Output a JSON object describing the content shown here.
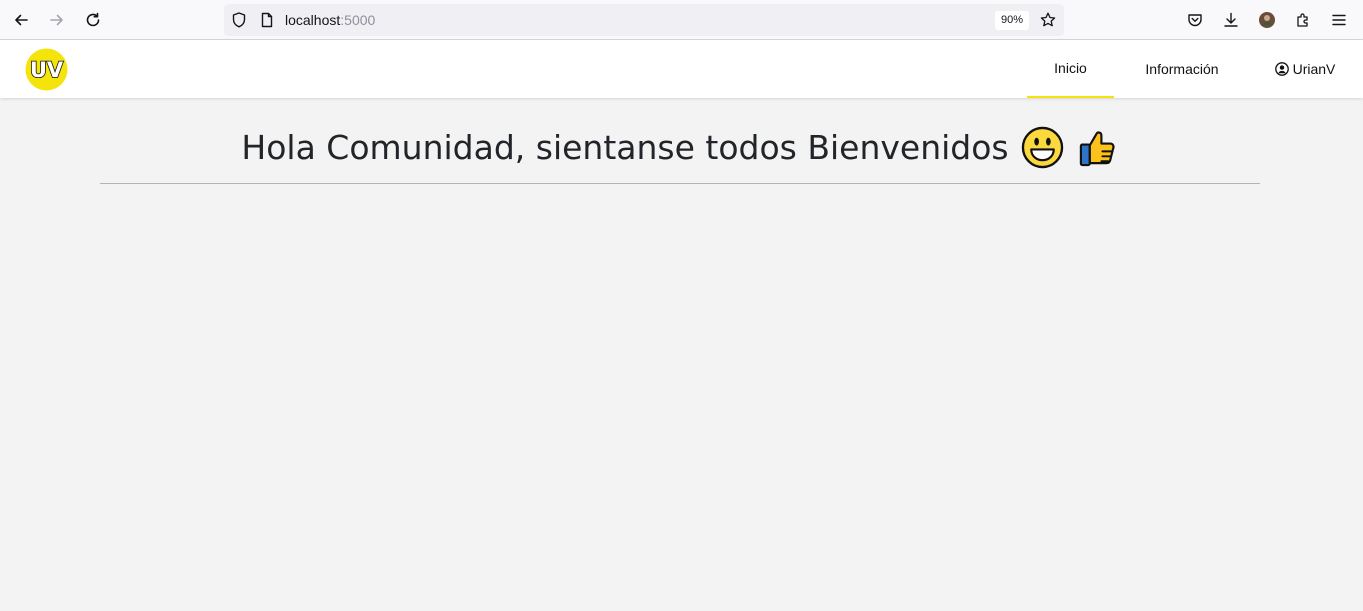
{
  "browser": {
    "url_host": "localhost",
    "url_port": ":5000",
    "zoom": "90%"
  },
  "nav": {
    "logo_text": "UV",
    "links": [
      {
        "label": "Inicio",
        "active": true
      },
      {
        "label": "Información",
        "active": false
      }
    ],
    "user": "UrianV",
    "accent": "#f5e30c"
  },
  "main": {
    "title": "Hola Comunidad, sientanse todos Bienvenidos",
    "emojis": [
      "grinning-face-icon",
      "thumbs-up-icon"
    ]
  }
}
